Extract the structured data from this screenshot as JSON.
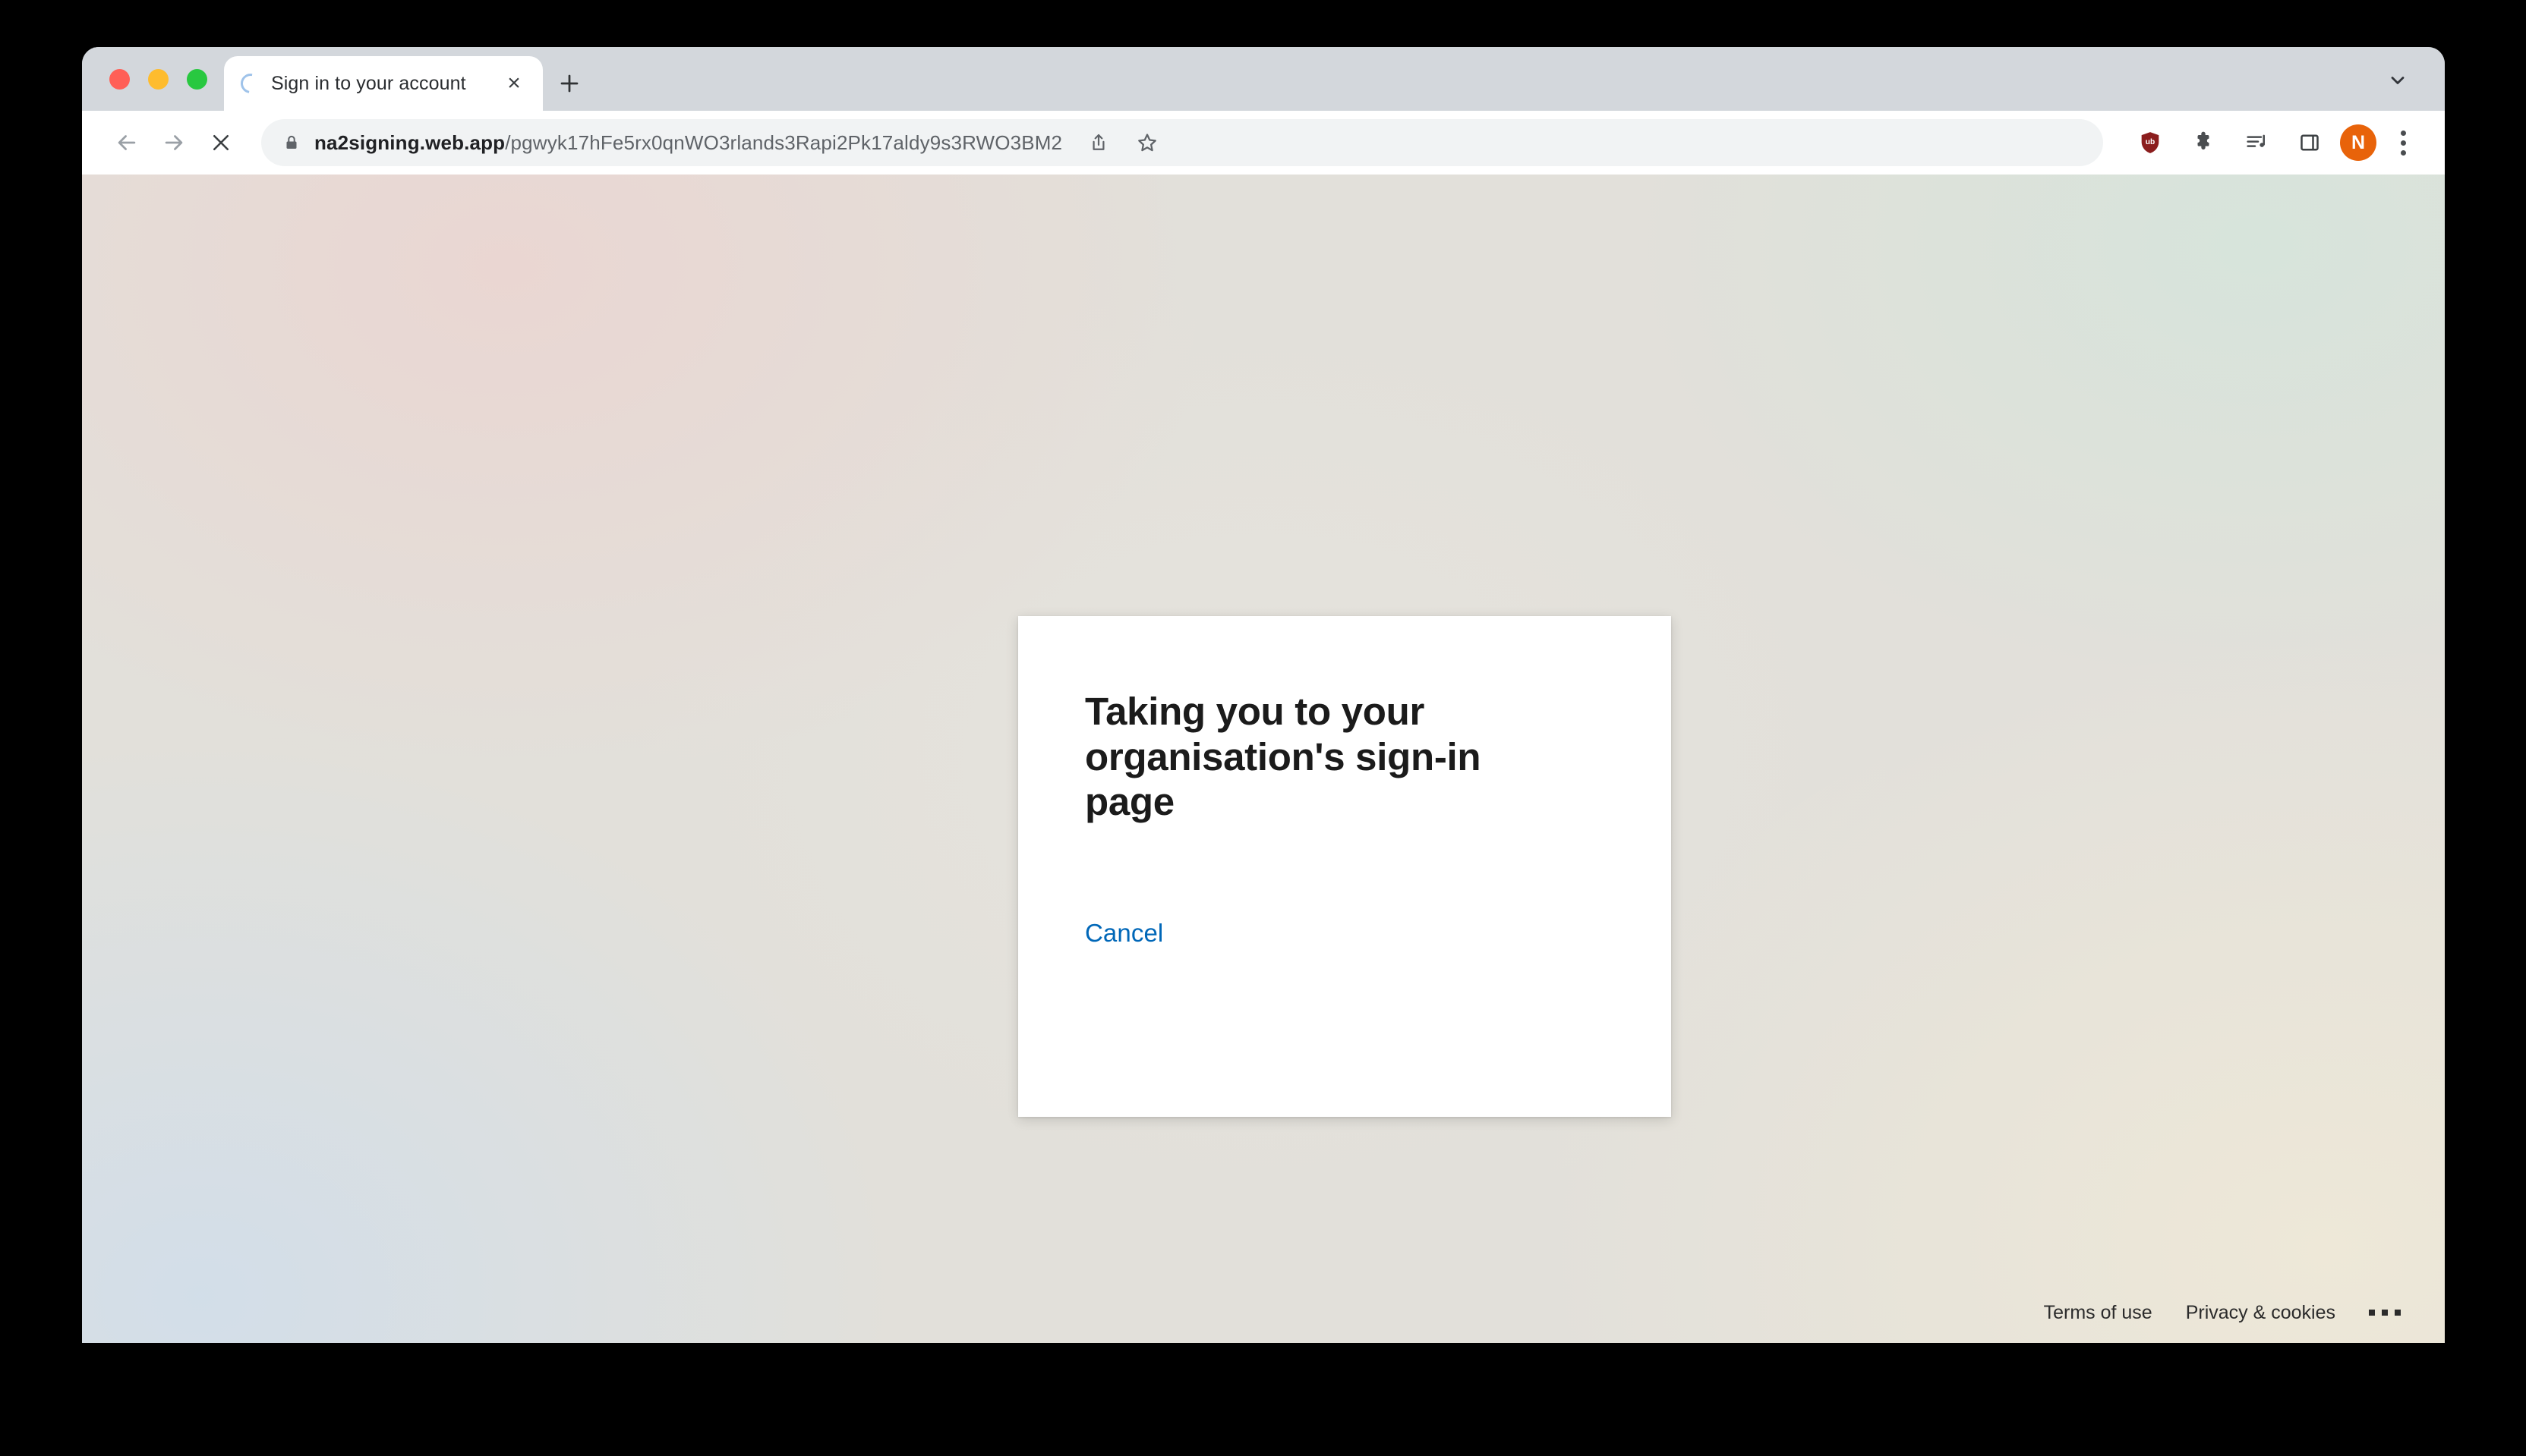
{
  "browser": {
    "window_controls": [
      {
        "name": "close",
        "color": "#ff5f57"
      },
      {
        "name": "minimize",
        "color": "#febc2e"
      },
      {
        "name": "maximize",
        "color": "#28c840"
      }
    ],
    "tab": {
      "title": "Sign in to your account",
      "loading": true,
      "close_label": "×"
    },
    "new_tab_label": "+",
    "toolbar": {
      "back_label": "Back",
      "forward_label": "Forward",
      "stop_label": "Stop loading",
      "url_host": "na2signing.web.app",
      "url_path": "/pgwyk17hFe5rx0qnWO3rlands3Rapi2Pk17aldy9s3RWO3BM2",
      "url_full": "na2signing.web.app/pgwyk17hFe5rx0qnWO3rlands3Rapi2Pk17aldy9s3RWO3BM2",
      "secure": true,
      "share_label": "Share this page",
      "bookmark_label": "Bookmark this tab",
      "ublock_label": "uBlock Origin",
      "extensions_label": "Extensions",
      "media_label": "Media playlist",
      "side_panel_label": "Side panel",
      "profile_initial": "N",
      "menu_label": "Customize and control Google Chrome"
    }
  },
  "page": {
    "title": "Sign in to your account",
    "card": {
      "heading": "Taking you to your organisation's sign-in page",
      "cancel_label": "Cancel"
    },
    "footer": {
      "terms_label": "Terms of use",
      "privacy_label": "Privacy & cookies",
      "more_label": "..."
    }
  },
  "colors": {
    "link_blue": "#0067b8",
    "avatar_orange": "#e8630a",
    "ublock_red": "#8b1d1d",
    "bg_pink": "#ead6d2",
    "bg_green": "#d6e4db",
    "bg_blue": "#d2dee9",
    "bg_cream": "#eee8d8",
    "card_white": "#ffffff"
  }
}
